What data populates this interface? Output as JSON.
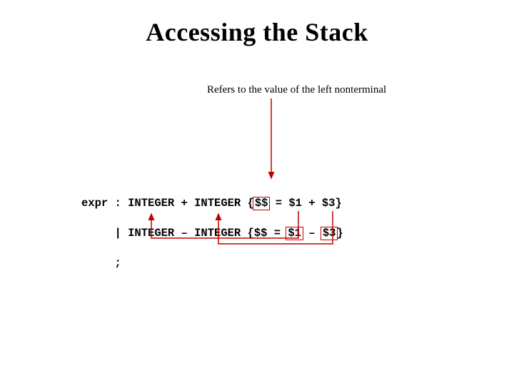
{
  "title": "Accessing the Stack",
  "annotation": "Refers to the value of the left nonterminal",
  "code": {
    "line1_a": "expr : INTEGER + INTEGER {",
    "line1_b": "$$",
    "line1_c": " = $1 + $3}",
    "line2_a": "     | INTEGER – INTEGER {$$ = ",
    "line2_b": "$1",
    "line2_c": " – ",
    "line2_d": "$3",
    "line2_e": "}",
    "line3": "     ;"
  }
}
